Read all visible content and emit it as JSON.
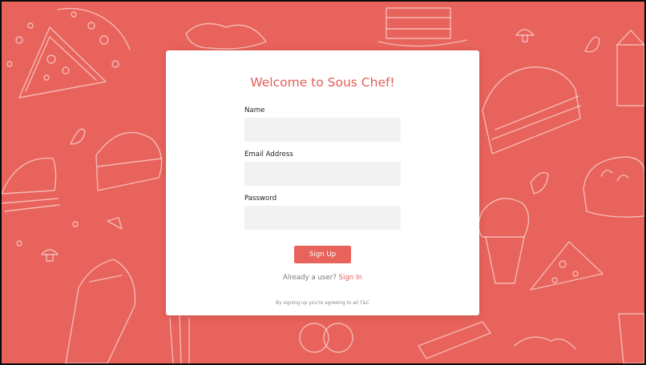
{
  "colors": {
    "background": "#e8635b",
    "accent": "#e35d56",
    "card": "#ffffff",
    "input_fill": "#f2f2f2"
  },
  "form": {
    "title": "Welcome to Sous Chef!",
    "name_label": "Name",
    "name_value": "",
    "email_label": "Email Address",
    "email_value": "",
    "password_label": "Password",
    "password_value": "",
    "submit_label": "Sign Up",
    "signin_prompt": "Already a user?",
    "signin_link": "Sign In",
    "terms": "By signing up you're agreeing to all T&C"
  }
}
